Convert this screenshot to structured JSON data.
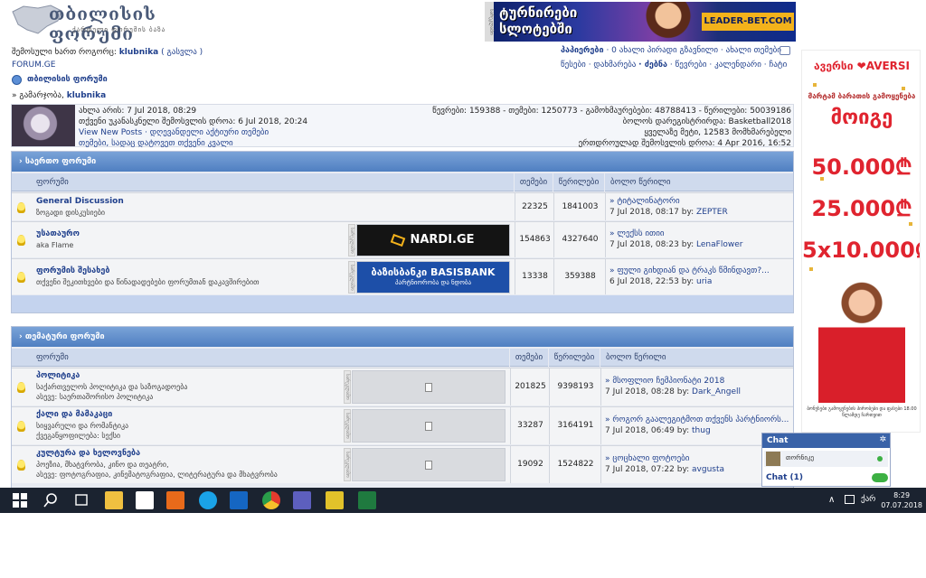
{
  "header": {
    "logo_title": "თბილისის ფორუმი",
    "logo_subtitle": "ქართული ფორუმის ბაზა",
    "banner_text_1": "ტურნირები",
    "banner_text_2": "სლოტებში",
    "banner_brand": "LEADER-BET.COM",
    "ad_tag": "სარეკლამო"
  },
  "user": {
    "logged_prefix": "შემოსული ხართ როგორც:",
    "username": "klubnika",
    "logout": "( გასვლა )",
    "site": "FORUM.GE"
  },
  "toplinks": {
    "row1": [
      "პაპიერები",
      "· 0 ახალი პირადი გზავნილი",
      "· ახალი თემები"
    ],
    "row2": [
      "წესები",
      "· დახმარება",
      "· ძებნა",
      "· წევრები",
      "· კალენდარი",
      "· ჩატი"
    ]
  },
  "breadcrumb": "თბილისის ფორუმი",
  "welcome": {
    "prefix": "» გამარჯობა,",
    "name": "klubnika"
  },
  "info": {
    "left": [
      "ახლა არის: 7 Jul 2018, 08:29",
      "თქვენი უკანასკნელი შემოსვლის დროა: 6 Jul 2018, 20:24",
      "View New Posts · დღევანდელი აქტიური თემები",
      "თემები, სადაც დატოვეთ თქვენი კვალი"
    ],
    "right": [
      "წევრები: 159388 - თემები: 1250773 - გამოხმაურებები: 48788413 - წერილები: 50039186",
      "ბოლოს დარეგისტრირდა: Basketball2018",
      "ყველაზე მეტი, 12583 მომხმარებელი",
      "ერთდროულად შემოსვლის დროა: 4 Apr 2016, 16:52"
    ]
  },
  "cat1": {
    "title": "› საერთო ფორუმი",
    "cols": [
      "ფორუმი",
      "თემები",
      "წერილები",
      "ბოლო წერილი"
    ],
    "rows": [
      {
        "name": "General Discussion",
        "desc": "ზოგადი დისკუსიები",
        "topics": "22325",
        "posts": "1841003",
        "last_title": "» ტიტალინატორი",
        "last_date": "7 Jul 2018, 08:17 by:",
        "last_by": "ZEPTER"
      },
      {
        "name": "უსათაურო",
        "desc": "aka Flame",
        "topics": "154863",
        "posts": "4327640",
        "last_title": "» ლექსს ითიი",
        "last_date": "7 Jul 2018, 08:23 by:",
        "last_by": "LenaFlower"
      },
      {
        "name": "ფორუმის შესახებ",
        "desc": "თქვენი შეკითხვები და წინადადებები ფორუმთან დაკავშირებით",
        "topics": "13338",
        "posts": "359388",
        "last_title": "» ფული გიხდიან და ტრაკს წმინდავთ?...",
        "last_date": "6 Jul 2018, 22:53 by:",
        "last_by": "uria"
      }
    ],
    "ad_nardi": "NARDI.GE",
    "ad_basis": "ბაზისბანკი BASISBANK",
    "ad_basis_sub": "პარტნიორობა და ნდობა"
  },
  "cat2": {
    "title": "› თემატური ფორუმი",
    "cols": [
      "ფორუმი",
      "თემები",
      "წერილები",
      "ბოლო წერილი"
    ],
    "rows": [
      {
        "name": "პოლიტიკა",
        "desc1": "საქართველოს პოლიტიკა და საზოგადოება",
        "desc2": "ასევე: საერთაშორისო პოლიტიკა",
        "topics": "201825",
        "posts": "9398193",
        "last_title": "» მსოფლიო ჩემპიონატი 2018",
        "last_date": "7 Jul 2018, 08:28 by:",
        "last_by": "Dark_Angell"
      },
      {
        "name": "ქალი და მამაკაცი",
        "desc1": "სიყვარული და რომანტიკა",
        "desc2": "ქვეგანყოფილება: სექსი",
        "topics": "33287",
        "posts": "3164191",
        "last_title": "» როგორ გაალეგიტმოთ თქვენს პარტნიორს...",
        "last_date": "7 Jul 2018, 06:49 by:",
        "last_by": "thug"
      },
      {
        "name": "კულტურა და ხელოვნება",
        "desc1": "პოეზია, მხატვრობა, კინო და თეატრი,",
        "desc2": "ასევე: ფოტოგრაფია, კინემატოგრაფია, ლიტერატურა და მხატვრობა",
        "topics": "19092",
        "posts": "1524822",
        "last_title": "» ცოცხალი ფოტოები",
        "last_date": "7 Jul 2018, 07:22 by:",
        "last_by": "avgusta"
      }
    ]
  },
  "right_ad": {
    "brand": "ავერსი ❤AVERSI",
    "line1": "მარტამ ბარათის გამოყენება",
    "win": "მოიგე",
    "amounts": [
      "50.000₾",
      "25.000₾",
      "5x10.000₾"
    ],
    "small": "ბონუსები გამოყენების პირობები და ფასები 18.00 წლამდე ჩართვით"
  },
  "chat": {
    "title": "Chat",
    "user": "თორნიკე",
    "count": "Chat (1)"
  },
  "taskbar": {
    "time": "8:29",
    "date": "07.07.2018",
    "lang": "ქარ"
  }
}
